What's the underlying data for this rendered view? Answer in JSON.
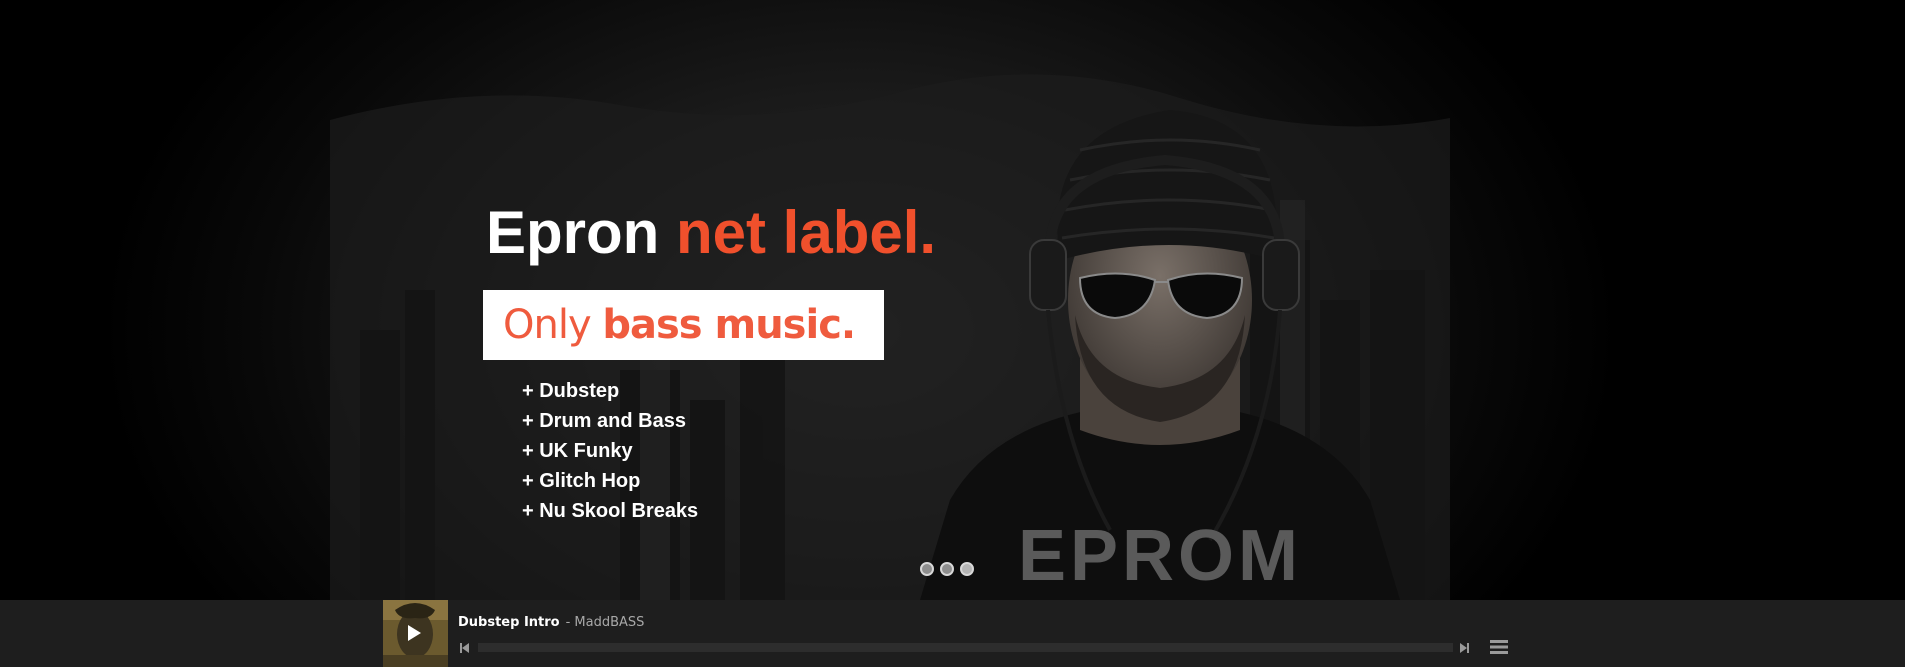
{
  "hero": {
    "headline_white": "Epron ",
    "headline_accent": "net label.",
    "tagline_light": "Only ",
    "tagline_bold": "bass music.",
    "genres": [
      "+ Dubstep",
      "+ Drum and Bass",
      "+ UK Funky",
      "+ Glitch Hop",
      "+ Nu Skool Breaks"
    ],
    "shirt_logo": "EPROM",
    "slider_count": 3,
    "slider_active": 3
  },
  "player": {
    "track_title": "Dubstep Intro",
    "track_artist": "- MaddBASS",
    "progress": 0
  },
  "colors": {
    "accent": "#f0502c",
    "tagline": "#ef5b3e",
    "player_bg": "#1e1e1e"
  },
  "icons": {
    "play": "play-icon",
    "prev": "skip-back-icon",
    "next": "skip-forward-icon",
    "playlist": "playlist-icon"
  }
}
